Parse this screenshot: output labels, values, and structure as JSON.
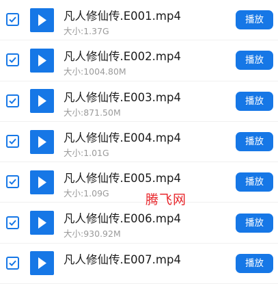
{
  "files": [
    {
      "name": "凡人修仙传.E001.mp4",
      "size": "大小:1.37G",
      "action": "播放",
      "checked": true
    },
    {
      "name": "凡人修仙传.E002.mp4",
      "size": "大小:1004.80M",
      "action": "播放",
      "checked": true
    },
    {
      "name": "凡人修仙传.E003.mp4",
      "size": "大小:871.50M",
      "action": "播放",
      "checked": true
    },
    {
      "name": "凡人修仙传.E004.mp4",
      "size": "大小:1.01G",
      "action": "播放",
      "checked": true
    },
    {
      "name": "凡人修仙传.E005.mp4",
      "size": "大小:1.09G",
      "action": "播放",
      "checked": true
    },
    {
      "name": "凡人修仙传.E006.mp4",
      "size": "大小:930.92M",
      "action": "播放",
      "checked": true
    },
    {
      "name": "凡人修仙传.E007.mp4",
      "size": "",
      "action": "播放",
      "checked": true
    }
  ],
  "watermark": "腾飞网",
  "icons": {
    "checkbox": "check-icon",
    "thumbnail": "play-icon"
  },
  "colors": {
    "accent": "#1677e6",
    "watermark": "#e8262b",
    "subtext": "#9a9a9a"
  }
}
